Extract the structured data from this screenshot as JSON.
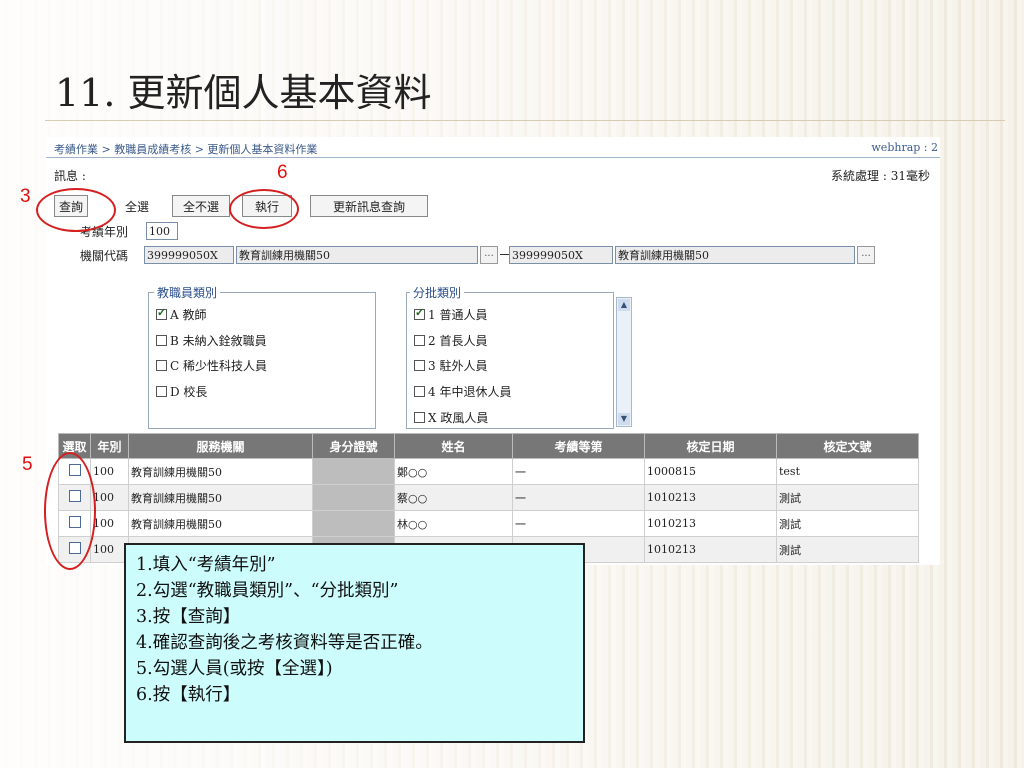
{
  "slide": {
    "title": "11. 更新個人基本資料"
  },
  "app": {
    "breadcrumb": "考績作業 > 教職員成績考核 > 更新個人基本資料作業",
    "corner_text": "webhrap : 2",
    "message_label": "訊息 :",
    "system_time": "系統處理 : 31毫秒"
  },
  "toolbar": {
    "query": "查詢",
    "select_all": "全選",
    "deselect_all": "全不選",
    "execute": "執行",
    "update_query": "更新訊息查詢"
  },
  "form": {
    "year_label": "考績年別",
    "year_value": "100",
    "org_label": "機關代碼",
    "org_code_from": "399999050X",
    "org_name_from": "教育訓練用機關50",
    "org_code_to": "399999050X",
    "org_name_to": "教育訓練用機關50",
    "lookup_label": "..."
  },
  "staff_type": {
    "legend": "教職員類別",
    "items": [
      {
        "label": "A 教師",
        "checked": true
      },
      {
        "label": "B 未納入銓敘職員",
        "checked": false
      },
      {
        "label": "C 稀少性科技人員",
        "checked": false
      },
      {
        "label": "D 校長",
        "checked": false
      }
    ]
  },
  "batch_type": {
    "legend": "分批類別",
    "items": [
      {
        "label": "1 普通人員",
        "checked": true
      },
      {
        "label": "2 首長人員",
        "checked": false
      },
      {
        "label": "3 駐外人員",
        "checked": false
      },
      {
        "label": "4 年中退休人員",
        "checked": false
      },
      {
        "label": "X 政風人員",
        "checked": false
      }
    ]
  },
  "table": {
    "headers": [
      "選取",
      "年別",
      "服務機關",
      "身分證號",
      "姓名",
      "考績等第",
      "核定日期",
      "核定文號"
    ],
    "rows": [
      {
        "year": "100",
        "org": "教育訓練用機關50",
        "id": "",
        "name": "鄭○○",
        "grade": "一",
        "date": "1000815",
        "doc": "test"
      },
      {
        "year": "100",
        "org": "教育訓練用機關50",
        "id": "",
        "name": "蔡○○",
        "grade": "一",
        "date": "1010213",
        "doc": "測試"
      },
      {
        "year": "100",
        "org": "教育訓練用機關50",
        "id": "",
        "name": "林○○",
        "grade": "一",
        "date": "1010213",
        "doc": "測試"
      },
      {
        "year": "100",
        "org": "",
        "id": "",
        "name": "",
        "grade": "",
        "date": "1010213",
        "doc": "測試"
      }
    ]
  },
  "annotations": {
    "n3": "3",
    "n5": "5",
    "n6": "6"
  },
  "note": {
    "lines": [
      "1.填入“考績年別”",
      "2.勾選“教職員類別”、“分批類別”",
      "3.按【查詢】",
      "4.確認查詢後之考核資料等是否正確。",
      "5.勾選人員(或按【全選】)",
      "6.按【執行】"
    ]
  },
  "colors": {
    "annotation_red": "#d42020",
    "note_bg": "#ccfcfc",
    "header_gray": "#777777"
  }
}
